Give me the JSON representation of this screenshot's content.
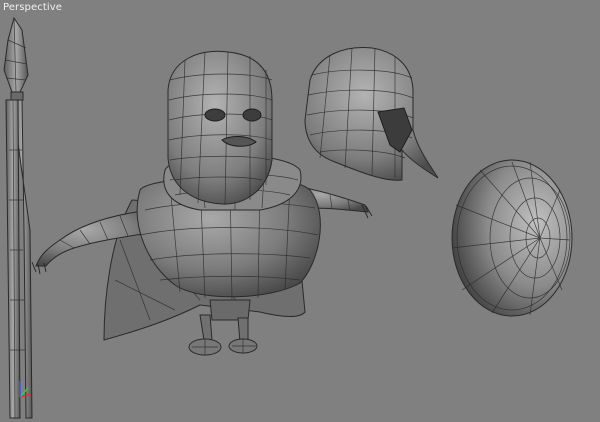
{
  "viewport": {
    "label": "Perspective",
    "background": "#808080"
  },
  "scene": {
    "objects": [
      "spear",
      "character",
      "helmet",
      "shield"
    ],
    "mesh_color": "#7a7a7a",
    "wire_color": "#2a2a2a"
  },
  "axis_gizmo": {
    "x_color": "#d83030",
    "y_color": "#3acb3a",
    "z_color": "#3a5ad8",
    "icon": "axis-gizmo-icon"
  }
}
